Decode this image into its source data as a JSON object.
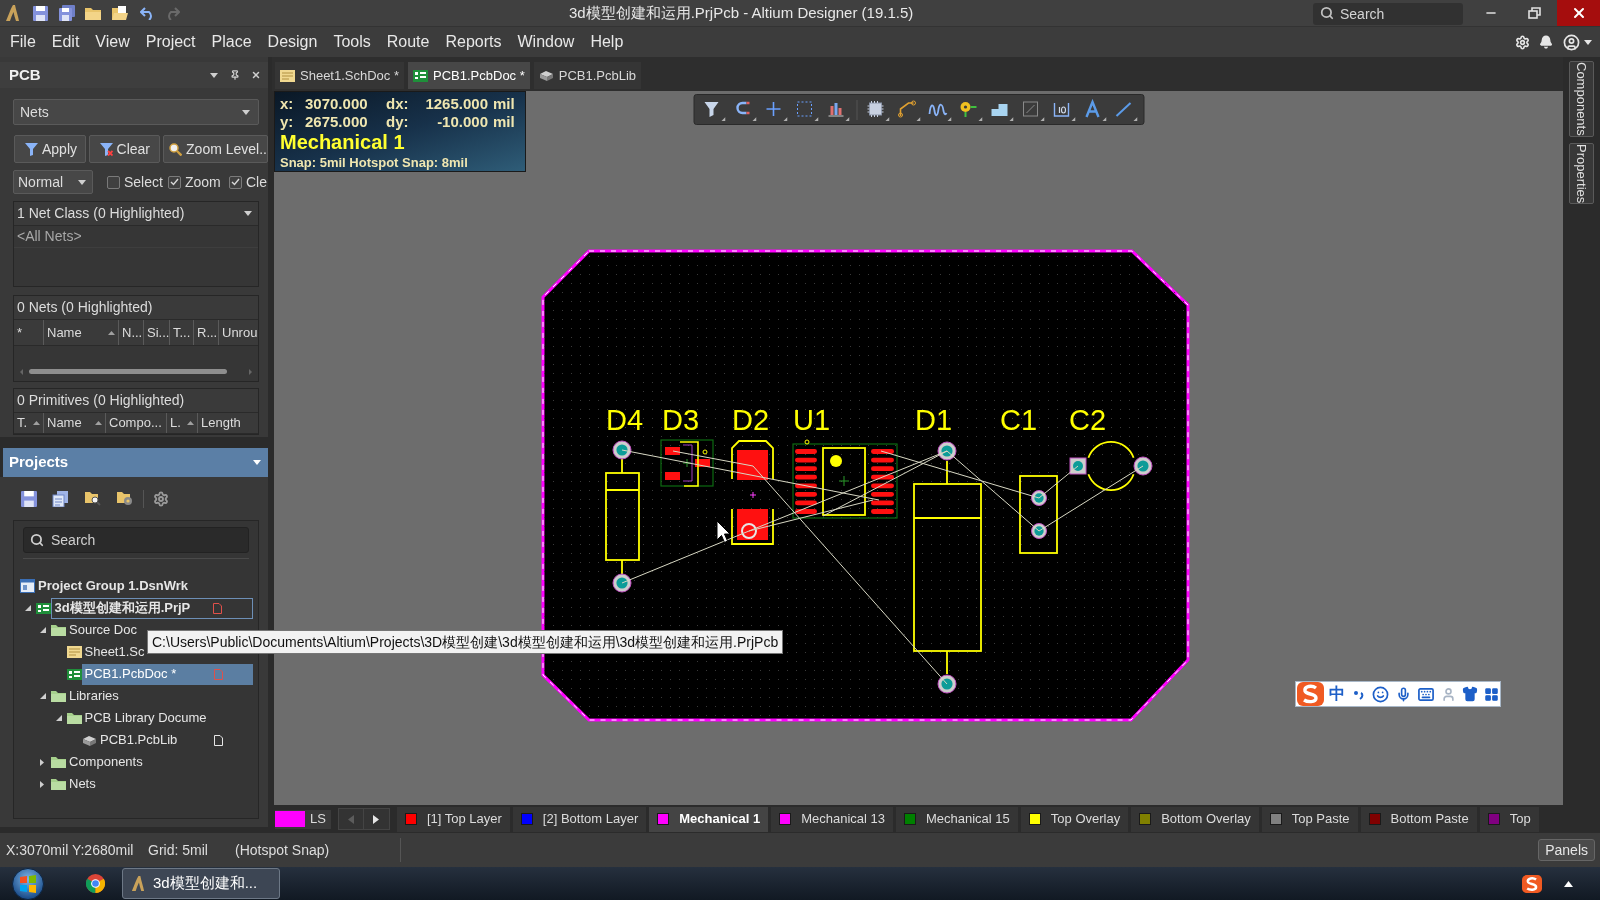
{
  "title_bar": {
    "title": "3d模型创建和运用.PrjPcb - Altium Designer (19.1.5)",
    "undo": {
      "disabled": false
    },
    "redo": {
      "disabled": true
    },
    "search": {
      "placeholder": "Search"
    }
  },
  "menu": [
    "File",
    "Edit",
    "View",
    "Project",
    "Place",
    "Design",
    "Tools",
    "Route",
    "Reports",
    "Window",
    "Help"
  ],
  "pcb_panel": {
    "title": "PCB",
    "mode": "Nets",
    "buttons": [
      {
        "label": "Apply",
        "kind": "apply"
      },
      {
        "label": "Clear",
        "kind": "clear"
      },
      {
        "label": "Zoom Level..",
        "kind": "zoom"
      }
    ],
    "highlight_mode": "Normal",
    "options": [
      {
        "label": "Select",
        "checked": false
      },
      {
        "label": "Zoom",
        "checked": true
      },
      {
        "label": "Cle",
        "checked": true
      }
    ],
    "net_classes": {
      "header": "1 Net Class (0 Highlighted)",
      "items": [
        {
          "label": "<All Nets>",
          "selected": false
        }
      ]
    },
    "nets": {
      "header": "0 Nets (0 Highlighted)",
      "columns": [
        {
          "label": "*",
          "sorted": false
        },
        {
          "label": "Name",
          "sorted": true
        },
        {
          "label": "N...",
          "sorted": false
        },
        {
          "label": "Si...",
          "sorted": false
        },
        {
          "label": "T...",
          "sorted": false
        },
        {
          "label": "R...",
          "sorted": false
        },
        {
          "label": "Unrou",
          "sorted": false
        }
      ]
    },
    "primitives": {
      "header": "0 Primitives (0 Highlighted)",
      "columns": [
        {
          "label": "T.",
          "sorted": true
        },
        {
          "label": "Name",
          "sorted": true
        },
        {
          "label": "Compo...",
          "sorted": false
        },
        {
          "label": "L.",
          "sorted": true
        },
        {
          "label": "Length",
          "sorted": false
        }
      ]
    }
  },
  "projects_panel": {
    "title": "Projects",
    "search": {
      "placeholder": "Search"
    },
    "tree": [
      {
        "label": "Project Group 1.DsnWrk",
        "kind": "group",
        "selected": false,
        "children": [
          {
            "label": "3d模型创建和运用.PrjP",
            "kind": "project",
            "expanded": true,
            "selected": false,
            "focused": true,
            "modified": true,
            "children": [
              {
                "label": "Source Doc",
                "kind": "folder",
                "expanded": true,
                "selected": false,
                "children": [
                  {
                    "label": "Sheet1.Sc",
                    "kind": "schematic",
                    "selected": false
                  },
                  {
                    "label": "PCB1.PcbDoc *",
                    "kind": "pcb",
                    "selected": true,
                    "modified": true
                  }
                ]
              },
              {
                "label": "Libraries",
                "kind": "folder",
                "expanded": true,
                "selected": false,
                "children": [
                  {
                    "label": "PCB Library Docume",
                    "kind": "folder",
                    "expanded": true,
                    "selected": false,
                    "children": [
                      {
                        "label": "PCB1.PcbLib",
                        "kind": "library",
                        "selected": false,
                        "modified": false
                      }
                    ]
                  }
                ]
              },
              {
                "label": "Components",
                "kind": "folder",
                "expanded": false,
                "selected": false
              },
              {
                "label": "Nets",
                "kind": "folder",
                "expanded": false,
                "selected": false
              }
            ]
          }
        ]
      }
    ]
  },
  "document_tabs": [
    {
      "label": "Sheet1.SchDoc *",
      "kind": "schematic",
      "selected": false
    },
    {
      "label": "PCB1.PcbDoc *",
      "kind": "pcb",
      "selected": true
    },
    {
      "label": "PCB1.PcbLib",
      "kind": "library",
      "selected": false
    }
  ],
  "coordinates_overlay": {
    "rows": [
      {
        "axis": "x:",
        "value": "3070.000",
        "delta_label": "dx:",
        "delta": "1265.000",
        "unit": "mil"
      },
      {
        "axis": "y:",
        "value": "2675.000",
        "delta_label": "dy:",
        "delta": "-10.000",
        "unit": "mil"
      }
    ],
    "layer": "Mechanical 1",
    "snap": "Snap: 5mil Hotspot Snap: 8mil"
  },
  "board": {
    "components": [
      {
        "designator": "D4",
        "kind": "axial"
      },
      {
        "designator": "D3",
        "kind": "sot"
      },
      {
        "designator": "D2",
        "kind": "smd"
      },
      {
        "designator": "U1",
        "kind": "soic"
      },
      {
        "designator": "D1",
        "kind": "barrel"
      },
      {
        "designator": "C1",
        "kind": "film"
      },
      {
        "designator": "C2",
        "kind": "radial"
      }
    ]
  },
  "input_method_bar": {
    "mode": "中"
  },
  "tooltip": {
    "text": "C:\\Users\\Public\\Documents\\Altium\\Projects\\3D模型创建\\3d模型创建和运用\\3d模型创建和运用.PrjPcb"
  },
  "layer_bar": {
    "layer_set": "LS",
    "scroll_left": {
      "disabled": true
    },
    "scroll_right": {
      "disabled": false
    },
    "layers": [
      {
        "label": "[1] Top Layer",
        "color": "#ff0000",
        "selected": false
      },
      {
        "label": "[2] Bottom Layer",
        "color": "#0000ff",
        "selected": false
      },
      {
        "label": "Mechanical 1",
        "color": "#ff00ff",
        "selected": true
      },
      {
        "label": "Mechanical 13",
        "color": "#ff00ff",
        "selected": false
      },
      {
        "label": "Mechanical 15",
        "color": "#008000",
        "selected": false
      },
      {
        "label": "Top Overlay",
        "color": "#ffff00",
        "selected": false
      },
      {
        "label": "Bottom Overlay",
        "color": "#808000",
        "selected": false
      },
      {
        "label": "Top Paste",
        "color": "#808080",
        "selected": false
      },
      {
        "label": "Bottom Paste",
        "color": "#800000",
        "selected": false
      },
      {
        "label": "Top",
        "color": "#800080",
        "selected": false
      }
    ]
  },
  "side_tabs": [
    "Components",
    "Properties"
  ],
  "status_bar": {
    "items": [
      "X:3070mil Y:2680mil",
      "Grid: 5mil",
      "(Hotspot Snap)"
    ],
    "panels_button": "Panels"
  },
  "taskbar": {
    "buttons": [
      {
        "label": "3d模型创建和..."
      }
    ]
  }
}
